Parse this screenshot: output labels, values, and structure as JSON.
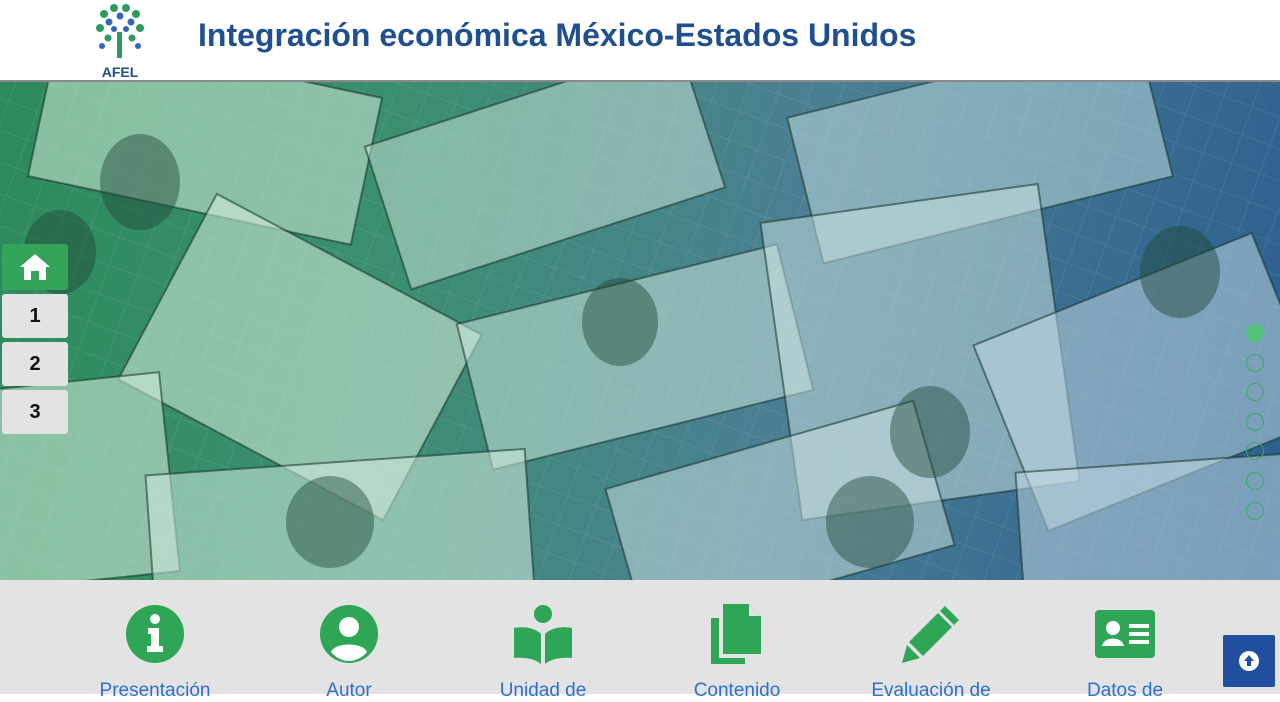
{
  "header": {
    "logo_text": "AFEL",
    "title": "Integración económica México-Estados Unidos"
  },
  "hero": {
    "background_description_icon": "money-bills-image"
  },
  "sidenav": {
    "home_icon": "home-icon",
    "items": [
      "1",
      "2",
      "3"
    ]
  },
  "slider_dots": {
    "count": 7,
    "active_index": 0
  },
  "menu": {
    "items": [
      {
        "icon": "info-circle-icon",
        "label": "Presentación"
      },
      {
        "icon": "user-circle-icon",
        "label": "Autor"
      },
      {
        "icon": "book-reader-icon",
        "label": "Unidad de"
      },
      {
        "icon": "copy-icon",
        "label": "Contenido"
      },
      {
        "icon": "pencil-icon",
        "label": "Evaluación de"
      },
      {
        "icon": "id-card-icon",
        "label": "Datos de"
      }
    ]
  },
  "colors": {
    "title": "#1f4f8e",
    "accent_green": "#33a45a",
    "menu_label": "#2f6fd0",
    "menu_bg": "#e3e3e3",
    "to_top_bg": "#1f4f9e"
  },
  "to_top": {
    "icon": "arrow-up-circle-icon"
  }
}
